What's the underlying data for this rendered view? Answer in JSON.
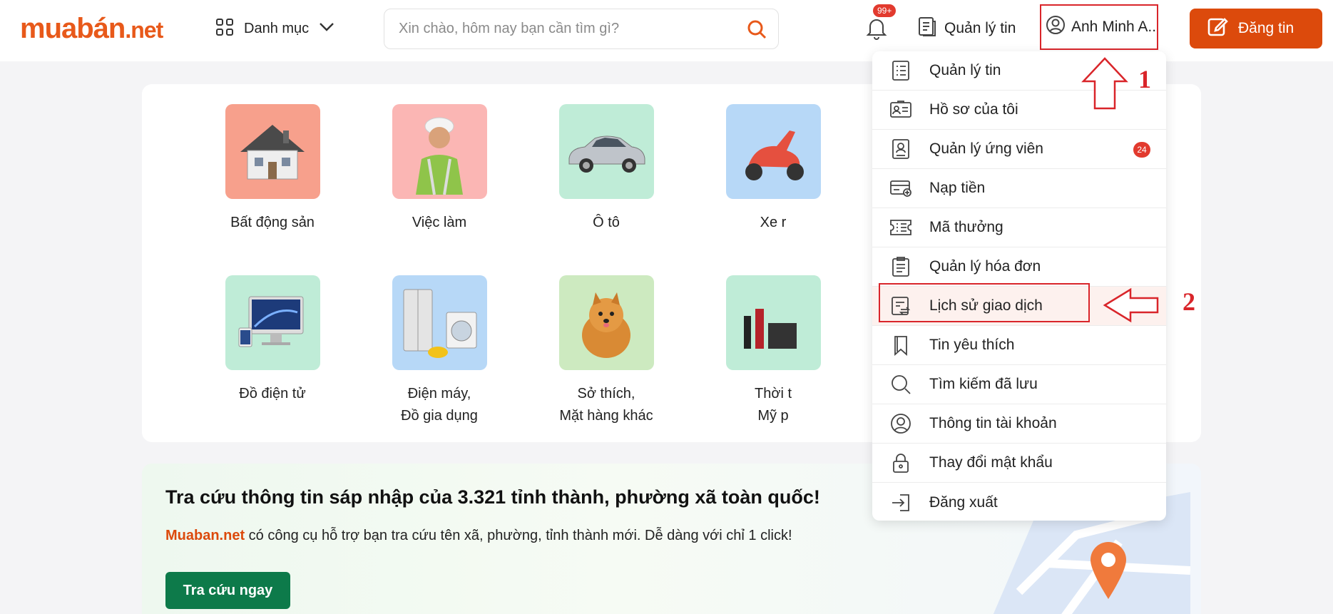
{
  "header": {
    "logo_part1": "muabán",
    "logo_part2": ".net",
    "category_label": "Danh mục",
    "search_placeholder": "Xin chào, hôm nay bạn cần tìm gì?",
    "notification_badge": "99+",
    "manage_label": "Quản lý tin",
    "user_name": "Anh Minh A..",
    "post_label": "Đăng tin"
  },
  "categories": [
    {
      "label": "Bất động sản",
      "label2": "",
      "color": "#f7a08c"
    },
    {
      "label": "Việc làm",
      "label2": "",
      "color": "#fbb6b4"
    },
    {
      "label": "Ô tô",
      "label2": "",
      "color": "#bfecd7"
    },
    {
      "label": "Xe r",
      "label2": "",
      "color": "#b7d8f7"
    },
    {
      "label": "Đồ điện tử",
      "label2": "",
      "color": "#bfecd7"
    },
    {
      "label": "Điện máy,",
      "label2": "Đồ gia dụng",
      "color": "#b7d8f7"
    },
    {
      "label": "Sở thích,",
      "label2": "Mặt hàng khác",
      "color": "#cdeac0"
    },
    {
      "label": "Thời t",
      "label2": "Mỹ p",
      "color": "#bfecd7"
    }
  ],
  "promo": {
    "title": "Tra cứu thông tin sáp nhập của 3.321 tỉnh thành, phường xã toàn quốc!",
    "brand": "Muaban.net",
    "desc": " có công cụ hỗ trợ bạn tra cứu tên xã, phường, tỉnh thành mới. Dễ dàng với chỉ 1 click!",
    "cta": "Tra cứu ngay"
  },
  "dropdown": {
    "items": [
      {
        "label": "Quản lý tin",
        "icon": "list-icon"
      },
      {
        "label": "Hồ sơ của tôi",
        "icon": "id-card-icon"
      },
      {
        "label": "Quản lý ứng viên",
        "icon": "candidate-icon",
        "count": "24"
      },
      {
        "label": "Nạp tiền",
        "icon": "wallet-icon"
      },
      {
        "label": "Mã thưởng",
        "icon": "voucher-icon"
      },
      {
        "label": "Quản lý hóa đơn",
        "icon": "invoice-icon"
      },
      {
        "label": "Lịch sử giao dịch",
        "icon": "transaction-history-icon"
      },
      {
        "label": "Tin yêu thích",
        "icon": "bookmark-icon"
      },
      {
        "label": "Tìm kiếm đã lưu",
        "icon": "search-icon"
      },
      {
        "label": "Thông tin tài khoản",
        "icon": "user-circle-icon"
      },
      {
        "label": "Thay đổi mật khẩu",
        "icon": "lock-icon"
      },
      {
        "label": "Đăng xuất",
        "icon": "logout-icon"
      }
    ]
  },
  "annotations": {
    "step1": "1",
    "step2": "2"
  },
  "colors": {
    "brand_orange": "#dc4a0c",
    "annotation_red": "#d9252a",
    "cta_green": "#0d7a4a"
  }
}
